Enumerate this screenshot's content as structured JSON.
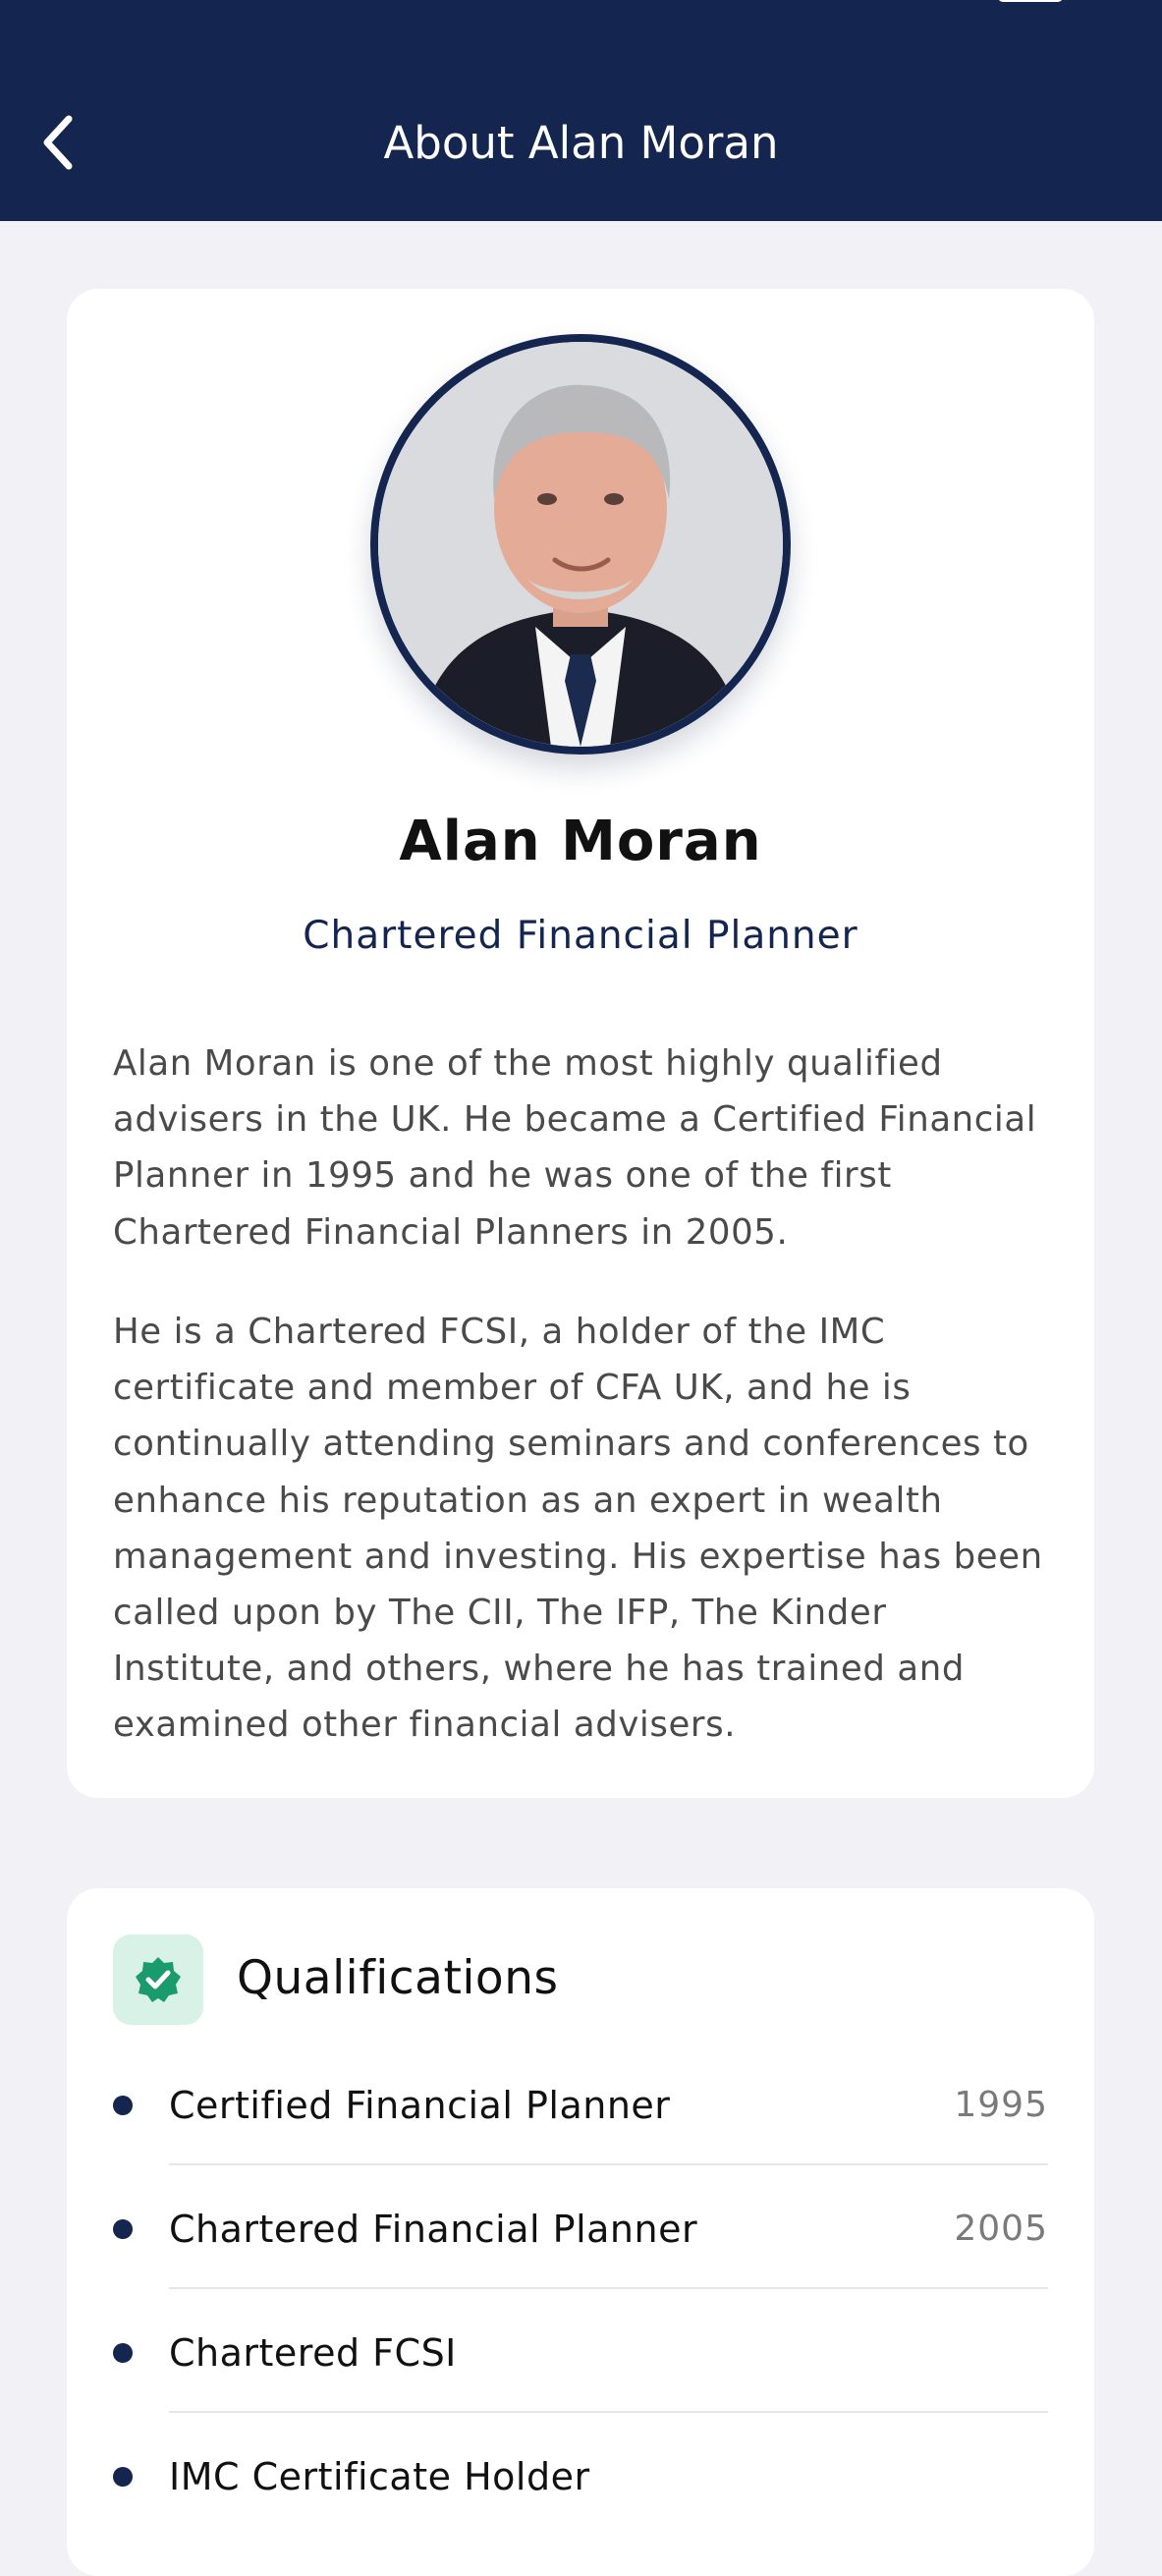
{
  "header": {
    "title": "About Alan Moran",
    "back_icon": "chevron-left-icon"
  },
  "profile": {
    "name": "Alan Moran",
    "role": "Chartered Financial Planner",
    "bio_paragraphs": [
      "Alan Moran is one of the most highly qualified advisers in the UK. He became a Certified Financial Planner in 1995 and he was one of the first Chartered Financial Planners in 2005.",
      "He is a Chartered FCSI, a holder of the IMC certificate and member of CFA UK, and he is continually attending seminars and conferences to enhance his reputation as an expert in wealth management and investing. His expertise has been called upon by The CII, The IFP, The Kinder Institute, and others, where he has trained and examined other financial advisers."
    ]
  },
  "qualifications": {
    "heading": "Qualifications",
    "icon": "verified-badge-icon",
    "items": [
      {
        "label": "Certified Financial Planner",
        "year": "1995"
      },
      {
        "label": "Chartered Financial Planner",
        "year": "2005"
      },
      {
        "label": "Chartered FCSI",
        "year": ""
      },
      {
        "label": "IMC Certificate Holder",
        "year": ""
      }
    ]
  },
  "colors": {
    "brand_navy": "#14254f",
    "page_background": "#f1f1f6",
    "card_background": "#ffffff",
    "accent_green": "#1a9b6c",
    "accent_green_bg": "#d9f2e8"
  }
}
